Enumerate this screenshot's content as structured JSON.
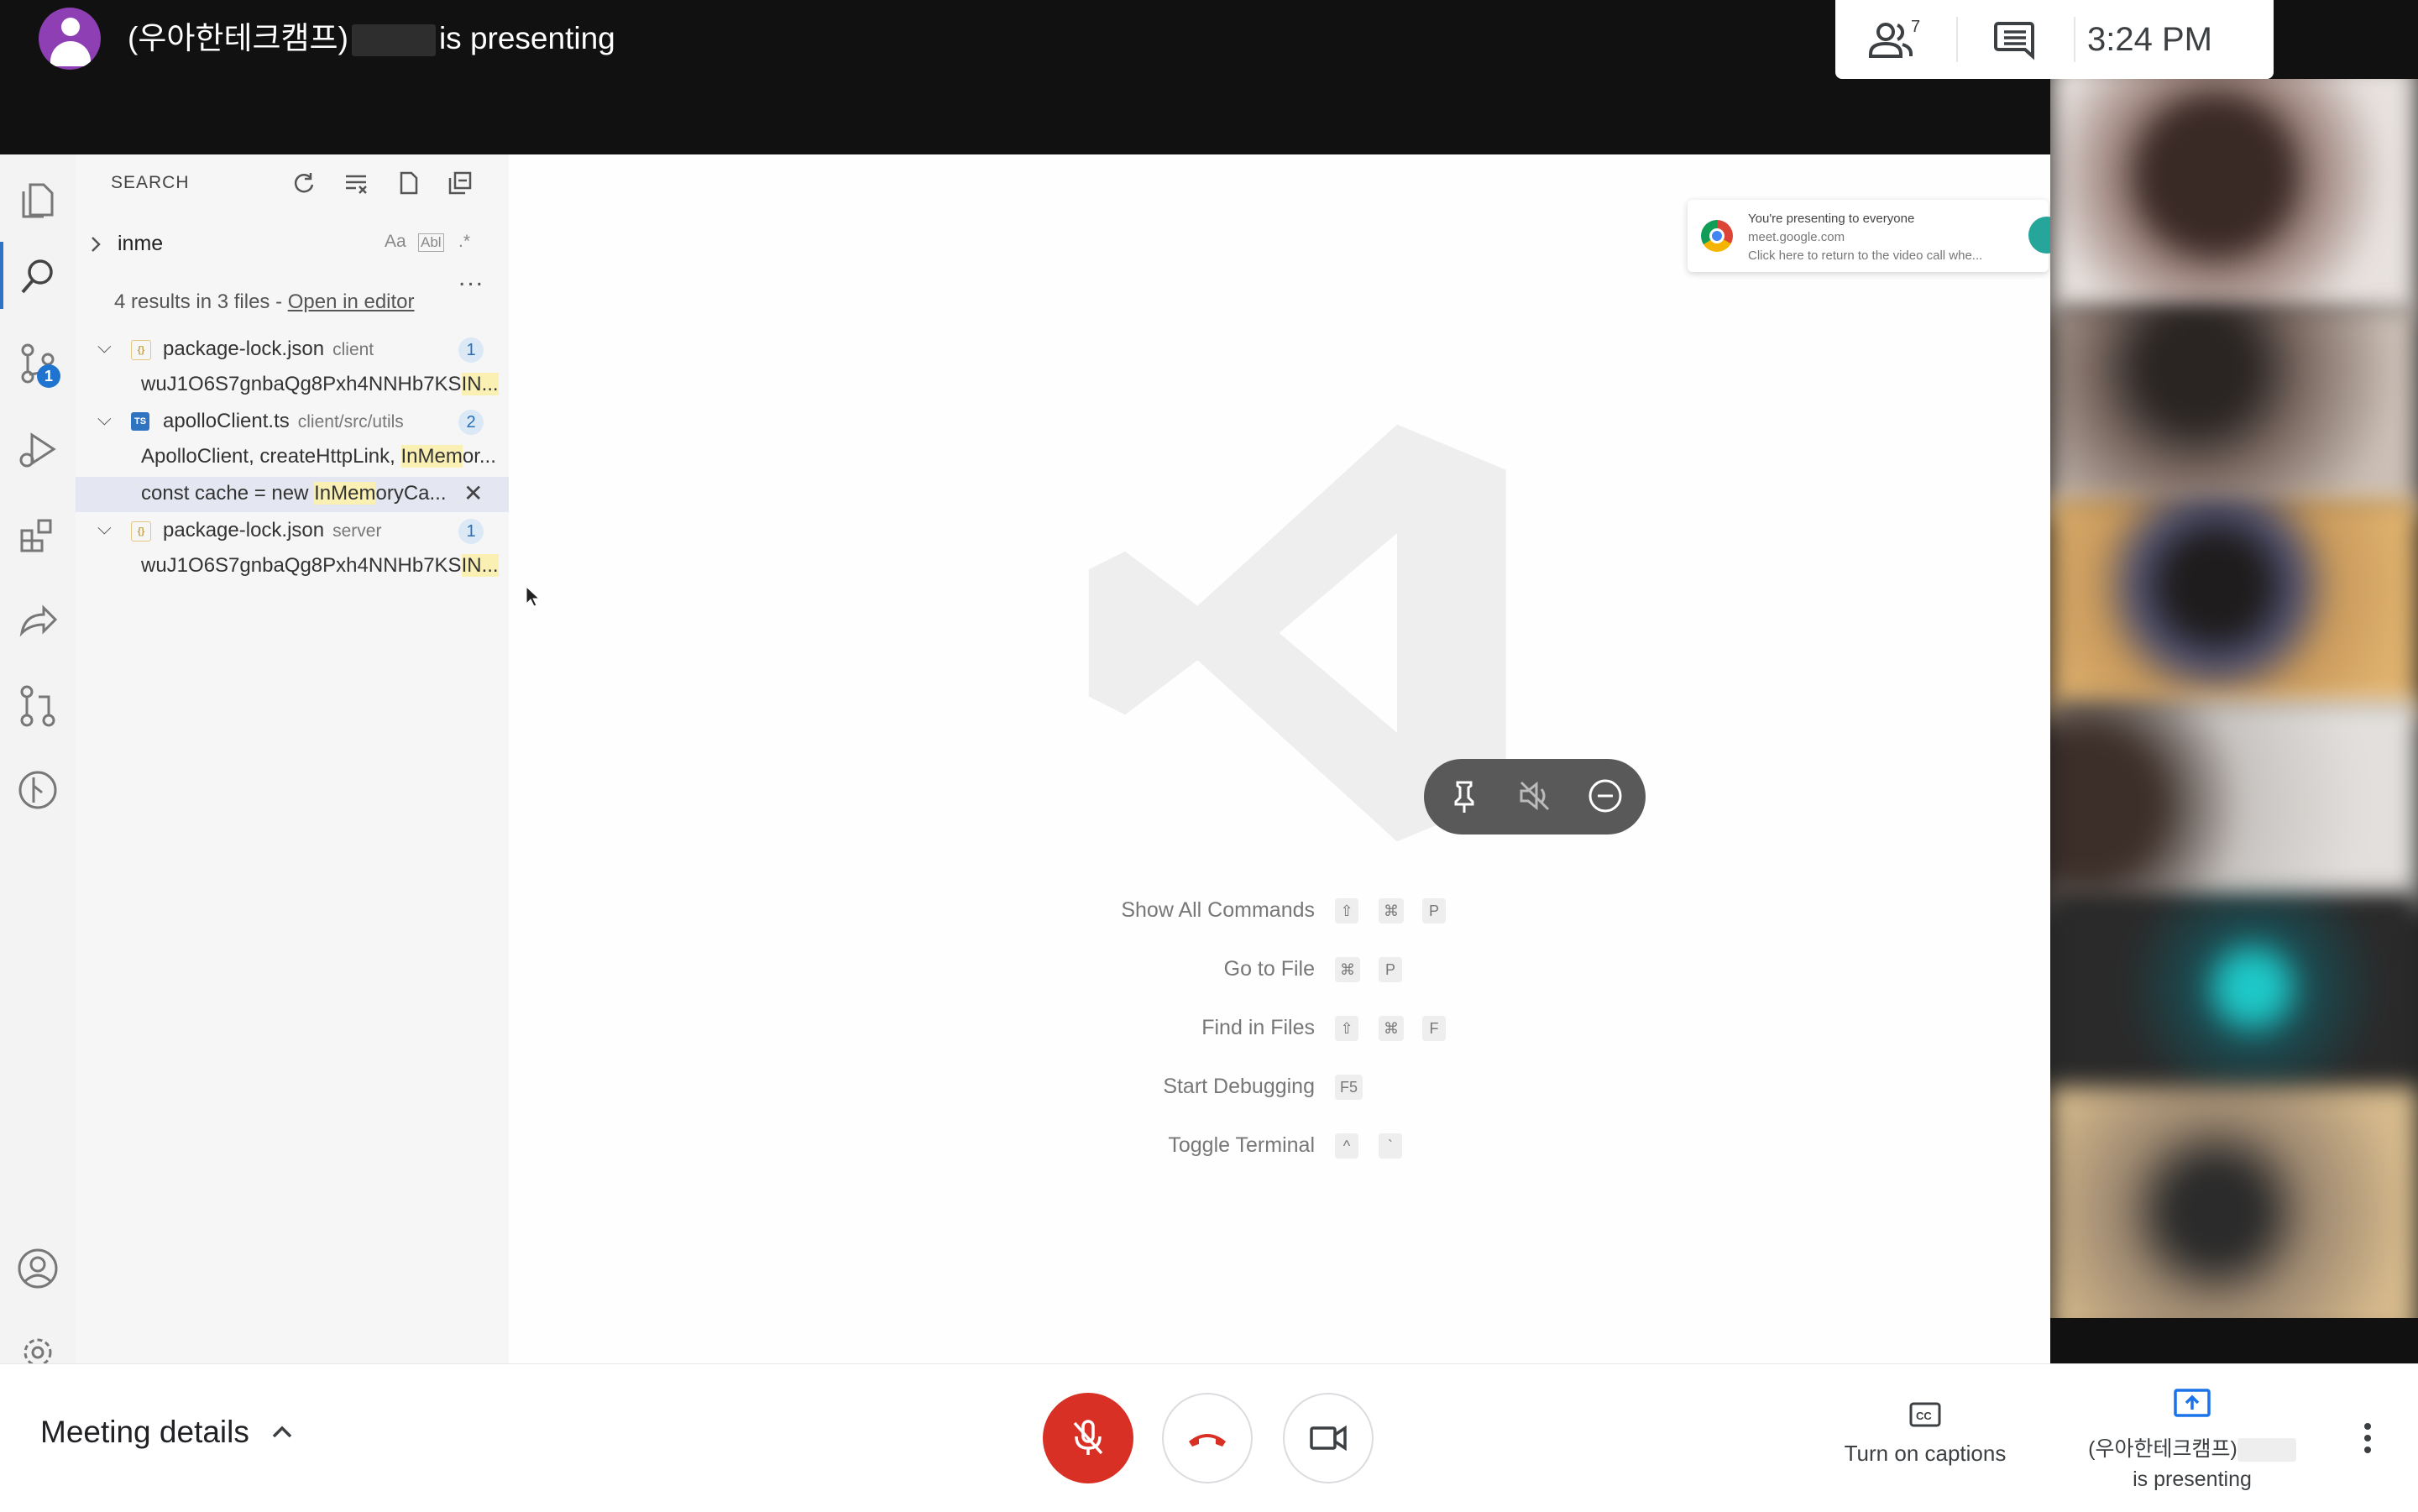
{
  "topbar": {
    "presenter_name": "(우아한테크캠프)",
    "presenting_suffix": "is presenting",
    "participants_count": "7",
    "people_icon": "people-icon",
    "chat_icon": "chat-icon",
    "time": "3:24 PM"
  },
  "vscode": {
    "search_title": "SEARCH",
    "search_query": "inme",
    "option_case": "Aa",
    "option_word": "Abl",
    "option_regex": ".*",
    "more": "...",
    "summary_prefix": "4 results in 3 files - ",
    "summary_link": "Open in editor",
    "scm_badge": "1",
    "results": [
      {
        "file": "package-lock.json",
        "dir": "client",
        "icon": "{}",
        "count": "1",
        "matches": [
          {
            "pre": "wuJ1O6S7gnbaQg8Pxh4NNHb7KS",
            "hit": "IN...",
            "post": ""
          }
        ]
      },
      {
        "file": "apolloClient.ts",
        "dir": "client/src/utils",
        "icon": "TS",
        "count": "2",
        "matches": [
          {
            "pre": "ApolloClient, createHttpLink, ",
            "hit": "InMem",
            "post": "or..."
          },
          {
            "pre": "const cache = new ",
            "hit": "InMem",
            "post": "oryCa..."
          }
        ]
      },
      {
        "file": "package-lock.json",
        "dir": "server",
        "icon": "{}",
        "count": "1",
        "matches": [
          {
            "pre": "wuJ1O6S7gnbaQg8Pxh4NNHb7KS",
            "hit": "IN...",
            "post": ""
          }
        ]
      }
    ],
    "close_glyph": "✕",
    "shortcuts": [
      {
        "label": "Show All Commands",
        "keys": [
          "⇧",
          "⌘",
          "P"
        ]
      },
      {
        "label": "Go to File",
        "keys": [
          "⌘",
          "P"
        ]
      },
      {
        "label": "Find in Files",
        "keys": [
          "⇧",
          "⌘",
          "F"
        ]
      },
      {
        "label": "Start Debugging",
        "keys": [
          "F5"
        ]
      },
      {
        "label": "Toggle Terminal",
        "keys": [
          "^",
          "`"
        ]
      }
    ],
    "notification": {
      "line1": "You're presenting to everyone",
      "line2": "meet.google.com",
      "line3": "Click here to return to the video call whe..."
    }
  },
  "bottombar": {
    "meeting_details": "Meeting details",
    "captions_label": "Turn on captions",
    "captions_icon": "cc-icon",
    "presenting_name": "(우아한테크캠프)",
    "presenting_label": "is presenting",
    "mic_state": "muted"
  },
  "colors": {
    "accent_red": "#d93025",
    "vscode_blue": "#1f74cf",
    "meet_teal": "#26a69a"
  }
}
